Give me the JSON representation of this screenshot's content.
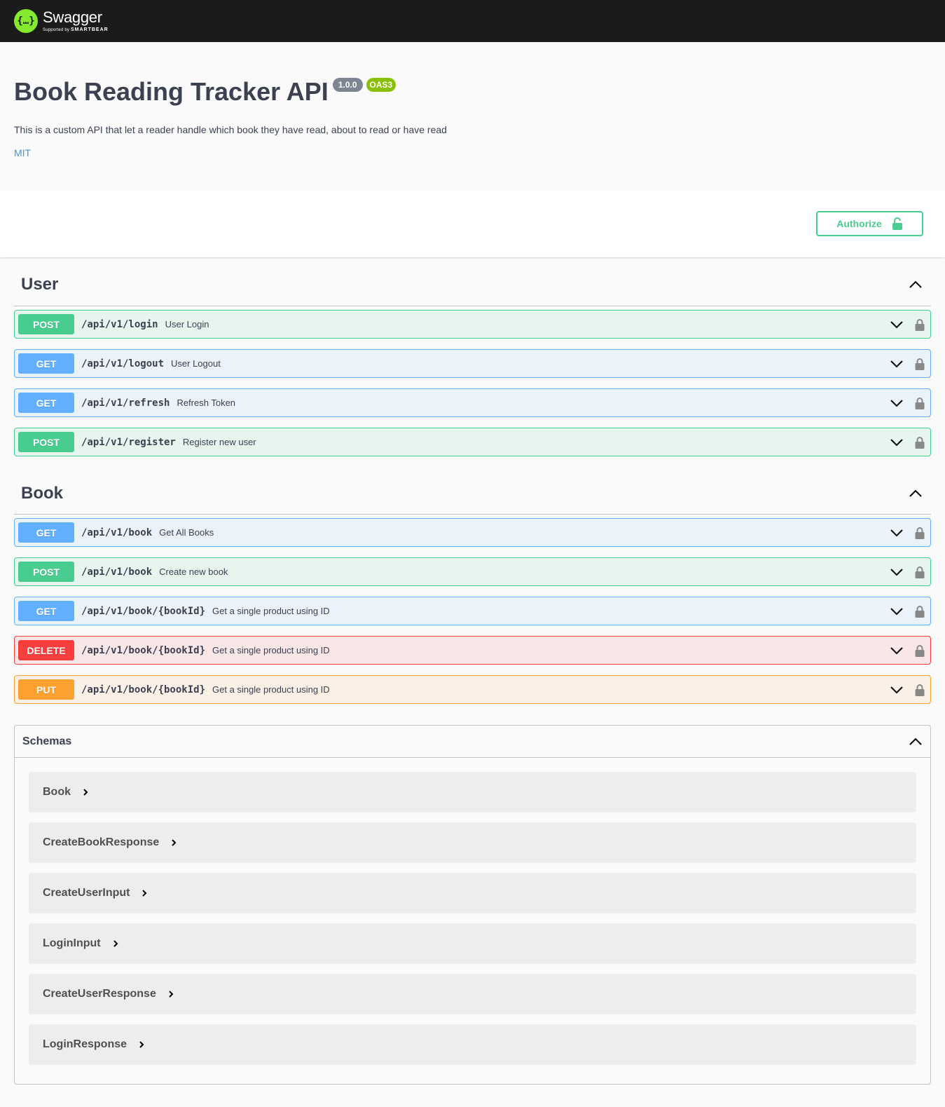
{
  "header": {
    "logo_name": "Swagger",
    "logo_sub_prefix": "Supported by",
    "logo_sub_brand": "SMARTBEAR",
    "logo_glyph": "{…}"
  },
  "info": {
    "title": "Book Reading Tracker API",
    "version": "1.0.0",
    "spec": "OAS3",
    "description": "This is a custom API that let a reader handle which book they have read, about to read or have read",
    "license": "MIT"
  },
  "authorize": {
    "label": "Authorize"
  },
  "tags": [
    {
      "name": "User",
      "operations": [
        {
          "method": "POST",
          "path": "/api/v1/login",
          "summary": "User Login"
        },
        {
          "method": "GET",
          "path": "/api/v1/logout",
          "summary": "User Logout"
        },
        {
          "method": "GET",
          "path": "/api/v1/refresh",
          "summary": "Refresh Token"
        },
        {
          "method": "POST",
          "path": "/api/v1/register",
          "summary": "Register new user"
        }
      ]
    },
    {
      "name": "Book",
      "operations": [
        {
          "method": "GET",
          "path": "/api/v1/book",
          "summary": "Get All Books"
        },
        {
          "method": "POST",
          "path": "/api/v1/book",
          "summary": "Create new book"
        },
        {
          "method": "GET",
          "path": "/api/v1/book/{bookId}",
          "summary": "Get a single product using ID"
        },
        {
          "method": "DELETE",
          "path": "/api/v1/book/{bookId}",
          "summary": "Get a single product using ID"
        },
        {
          "method": "PUT",
          "path": "/api/v1/book/{bookId}",
          "summary": "Get a single product using ID"
        }
      ]
    }
  ],
  "schemas": {
    "title": "Schemas",
    "items": [
      "Book",
      "CreateBookResponse",
      "CreateUserInput",
      "LoginInput",
      "CreateUserResponse",
      "LoginResponse"
    ]
  },
  "colors": {
    "post": "#49cc90",
    "get": "#61affe",
    "delete": "#f93e3e",
    "put": "#fca130",
    "topbar": "#1b1b1b",
    "logo_green": "#85ea2d"
  }
}
